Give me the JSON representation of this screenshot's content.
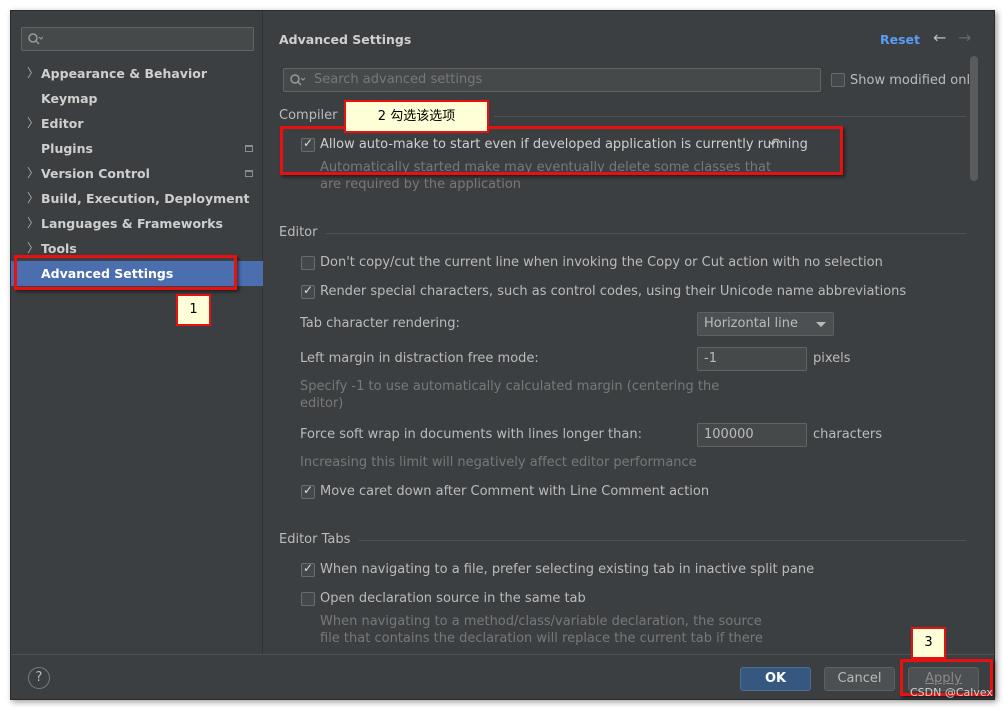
{
  "sidebar": {
    "search_placeholder": "",
    "items": [
      {
        "label": "Appearance & Behavior",
        "chevron": true
      },
      {
        "label": "Keymap",
        "chevron": false
      },
      {
        "label": "Editor",
        "chevron": true
      },
      {
        "label": "Plugins",
        "chevron": false
      },
      {
        "label": "Version Control",
        "chevron": true
      },
      {
        "label": "Build, Execution, Deployment",
        "chevron": true
      },
      {
        "label": "Languages & Frameworks",
        "chevron": true
      },
      {
        "label": "Tools",
        "chevron": true
      },
      {
        "label": "Advanced Settings",
        "chevron": false,
        "selected": true
      }
    ]
  },
  "header": {
    "title": "Advanced Settings",
    "reset_label": "Reset",
    "back_arrow": "←",
    "forward_arrow": "→"
  },
  "search": {
    "placeholder": "Search advanced settings",
    "show_modified_label": "Show modified only"
  },
  "compiler": {
    "section_label": "Compiler",
    "auto_make_label": "Allow auto-make to start even if developed application is currently running",
    "auto_make_checked": true,
    "auto_make_hint_1": "Automatically started make may eventually delete some classes that",
    "auto_make_hint_2": "are required by the application",
    "revert_icon": "undo-icon"
  },
  "editor": {
    "section_label": "Editor",
    "dont_copy_label": "Don't copy/cut the current line when invoking the Copy or Cut action with no selection",
    "dont_copy_checked": false,
    "render_special_label": "Render special characters, such as control codes, using their Unicode name abbreviations",
    "render_special_checked": true,
    "tab_rendering_label": "Tab character rendering:",
    "tab_rendering_value": "Horizontal line",
    "left_margin_label": "Left margin in distraction free mode:",
    "left_margin_value": "-1",
    "left_margin_unit": "pixels",
    "left_margin_hint_1": "Specify -1 to use automatically calculated margin (centering the",
    "left_margin_hint_2": "editor)",
    "soft_wrap_label": "Force soft wrap in documents with lines longer than:",
    "soft_wrap_value": "100000",
    "soft_wrap_unit": "characters",
    "soft_wrap_hint": "Increasing this limit will negatively affect editor performance",
    "move_caret_label": "Move caret down after Comment with Line Comment action",
    "move_caret_checked": true
  },
  "editor_tabs": {
    "section_label": "Editor Tabs",
    "prefer_existing_label": "When navigating to a file, prefer selecting existing tab in inactive split pane",
    "prefer_existing_checked": true,
    "open_same_tab_label": "Open declaration source in the same tab",
    "open_same_tab_checked": false,
    "open_same_tab_hint_1": "When navigating to a method/class/variable declaration, the source",
    "open_same_tab_hint_2": "file that contains the declaration will replace the current tab if there"
  },
  "footer": {
    "help_label": "?",
    "ok_label": "OK",
    "cancel_label": "Cancel",
    "apply_label": "Apply"
  },
  "annotations": {
    "note_1": "1",
    "note_2": "2 勾选该选项",
    "note_3": "3",
    "color": "#e81010"
  },
  "watermark": "CSDN @Calvex",
  "colors": {
    "accent": "#589df6",
    "selection": "#4b6eaf",
    "ok_button": "#365880",
    "background": "#3c3f41"
  }
}
